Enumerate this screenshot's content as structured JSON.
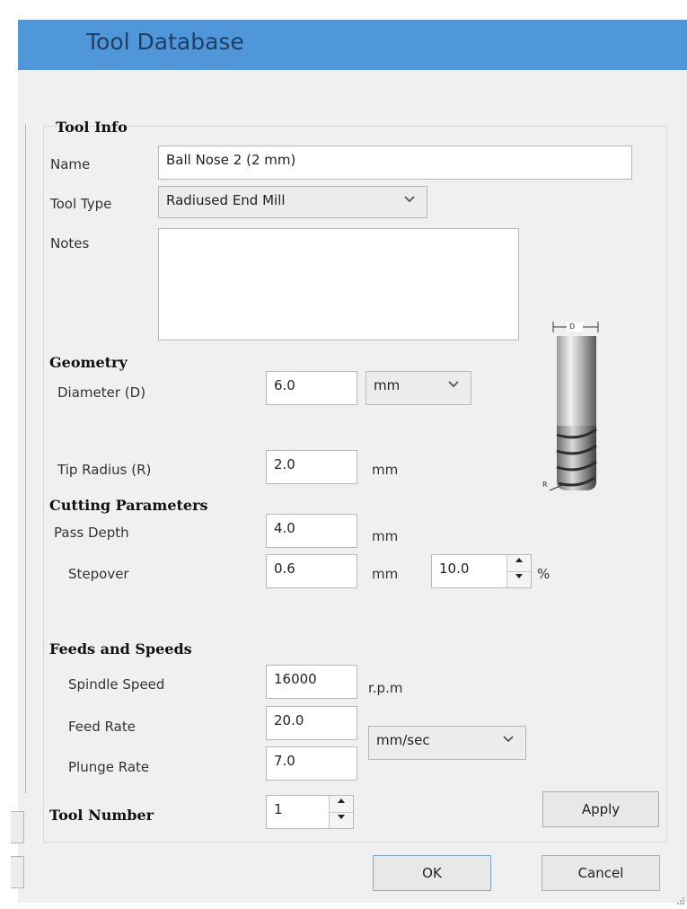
{
  "window": {
    "title": "Tool Database"
  },
  "tool_info": {
    "heading": "Tool Info",
    "name_label": "Name",
    "name_value": "Ball Nose 2 (2 mm)",
    "tool_type_label": "Tool Type",
    "tool_type_value": "Radiused End Mill",
    "notes_label": "Notes",
    "notes_value": ""
  },
  "geometry": {
    "heading": "Geometry",
    "diameter_label": "Diameter (D)",
    "diameter_value": "6.0",
    "units_value": "mm",
    "tip_radius_label": "Tip Radius (R)",
    "tip_radius_value": "2.0",
    "tip_radius_unit": "mm",
    "diagram_d": "D",
    "diagram_r": "R"
  },
  "cutting": {
    "heading": "Cutting Parameters",
    "pass_depth_label": "Pass Depth",
    "pass_depth_value": "4.0",
    "pass_depth_unit": "mm",
    "stepover_label": "Stepover",
    "stepover_value": "0.6",
    "stepover_unit": "mm",
    "stepover_percent_value": "10.0",
    "percent_sign": "%"
  },
  "feeds": {
    "heading": "Feeds and Speeds",
    "spindle_label": "Spindle Speed",
    "spindle_value": "16000",
    "spindle_unit": "r.p.m",
    "feed_label": "Feed Rate",
    "feed_value": "20.0",
    "plunge_label": "Plunge Rate",
    "plunge_value": "7.0",
    "rate_units_value": "mm/sec"
  },
  "tool_number": {
    "label": "Tool Number",
    "value": "1"
  },
  "buttons": {
    "apply": "Apply",
    "ok": "OK",
    "cancel": "Cancel"
  },
  "icons": {
    "dropdown": "chevron-down-icon",
    "spin_up": "triangle-up-icon",
    "spin_down": "triangle-down-icon"
  },
  "colors": {
    "titlebar": "#4f97d9",
    "title_text": "#1e3f66",
    "dialog_bg": "#f0f0f0"
  }
}
